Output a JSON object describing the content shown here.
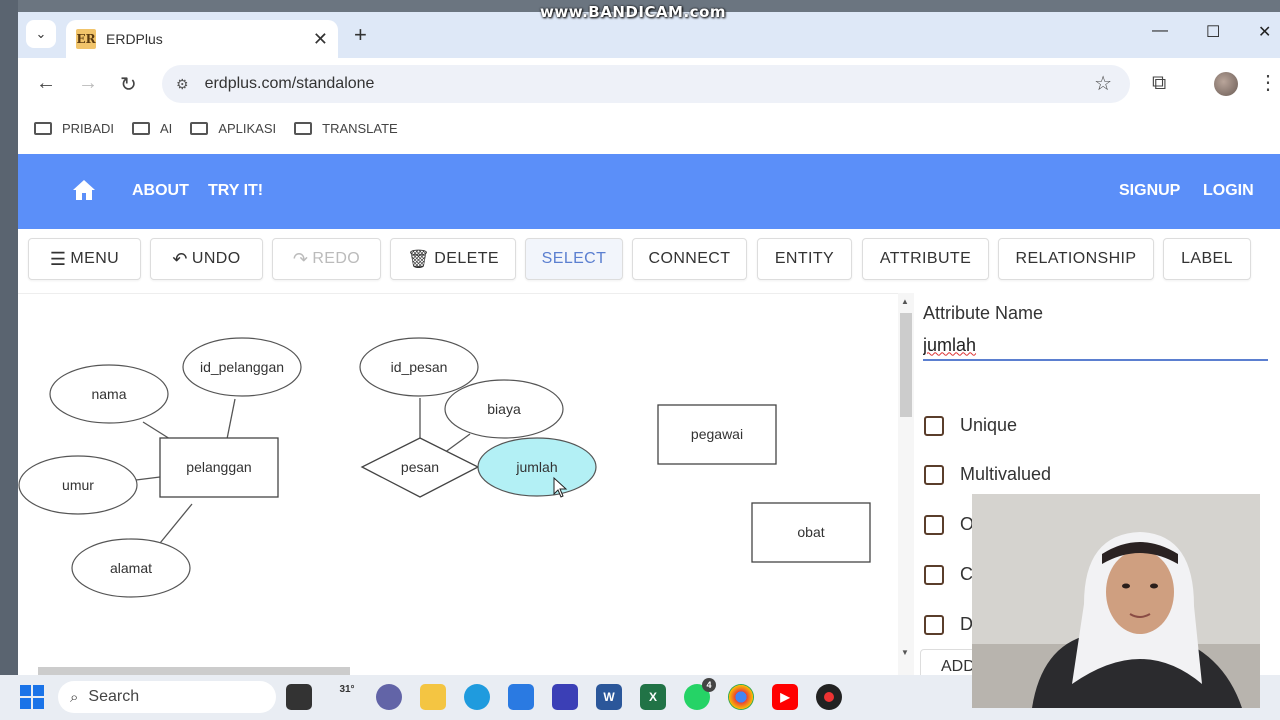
{
  "watermark": "www.BANDICAM.com",
  "browser": {
    "tab_title": "ERDPlus",
    "favicon_text": "ER",
    "url": "erdplus.com/standalone",
    "bookmarks": [
      "PRIBADI",
      "AI",
      "APLIKASI",
      "TRANSLATE"
    ]
  },
  "app_nav": {
    "about": "ABOUT",
    "try_it": "TRY IT!",
    "signup": "SIGNUP",
    "login": "LOGIN"
  },
  "toolbar": {
    "menu": "MENU",
    "undo": "UNDO",
    "redo": "REDO",
    "delete": "DELETE",
    "select": "SELECT",
    "connect": "CONNECT",
    "entity": "ENTITY",
    "attribute": "ATTRIBUTE",
    "relationship": "RELATIONSHIP",
    "label": "LABEL"
  },
  "diagram": {
    "entities": [
      "pelanggan",
      "pegawai",
      "obat"
    ],
    "relationships": [
      "pesan"
    ],
    "attributes": [
      "nama",
      "id_pelanggan",
      "umur",
      "alamat",
      "id_pesan",
      "biaya",
      "jumlah"
    ],
    "selected_attribute": "jumlah",
    "selected_fill": "#b3f0f5"
  },
  "panel": {
    "attr_label": "Attribute Name",
    "attr_value": "jumlah",
    "checkboxes": [
      "Unique",
      "Multivalued",
      "O",
      "C",
      "D"
    ],
    "add_button": "ADD"
  },
  "taskbar": {
    "search": "Search",
    "weather": "31°",
    "whatsapp_badge": "4"
  },
  "colors": {
    "nav_blue": "#5b8ff9",
    "selected_text": "#5b7fd0"
  }
}
